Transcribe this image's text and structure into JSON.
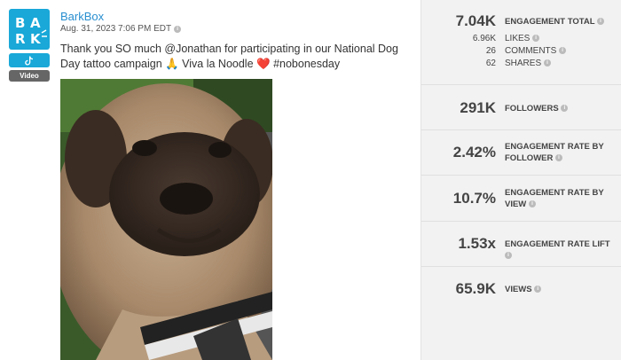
{
  "post": {
    "platform_chip": "Video",
    "author": "BarkBox",
    "timestamp": "Aug. 31, 2023 7:06 PM EDT",
    "text": "Thank you SO much @Jonathan for participating in our National Dog Day tattoo campaign 🙏 Viva la Noodle ❤️ #nobonesday",
    "logo_letters": [
      "B",
      "A",
      "R",
      "K"
    ]
  },
  "metrics": {
    "engagement_total": {
      "value": "7.04K",
      "label": "ENGAGEMENT TOTAL"
    },
    "likes": {
      "value": "6.96K",
      "label": "LIKES"
    },
    "comments": {
      "value": "26",
      "label": "COMMENTS"
    },
    "shares": {
      "value": "62",
      "label": "SHARES"
    },
    "followers": {
      "value": "291K",
      "label": "FOLLOWERS"
    },
    "engagement_rate_follower": {
      "value": "2.42%",
      "label": "ENGAGEMENT RATE BY FOLLOWER"
    },
    "engagement_rate_view": {
      "value": "10.7%",
      "label": "ENGAGEMENT RATE BY VIEW"
    },
    "engagement_rate_lift": {
      "value": "1.53x",
      "label": "ENGAGEMENT RATE LIFT"
    },
    "views": {
      "value": "65.9K",
      "label": "VIEWS"
    }
  },
  "colors": {
    "brand": "#19a8d8",
    "link": "#2a8fd0",
    "panel": "#f2f2f2"
  },
  "icons": [
    "barkbox-logo",
    "tiktok-icon",
    "info-icon",
    "pug-photo"
  ]
}
